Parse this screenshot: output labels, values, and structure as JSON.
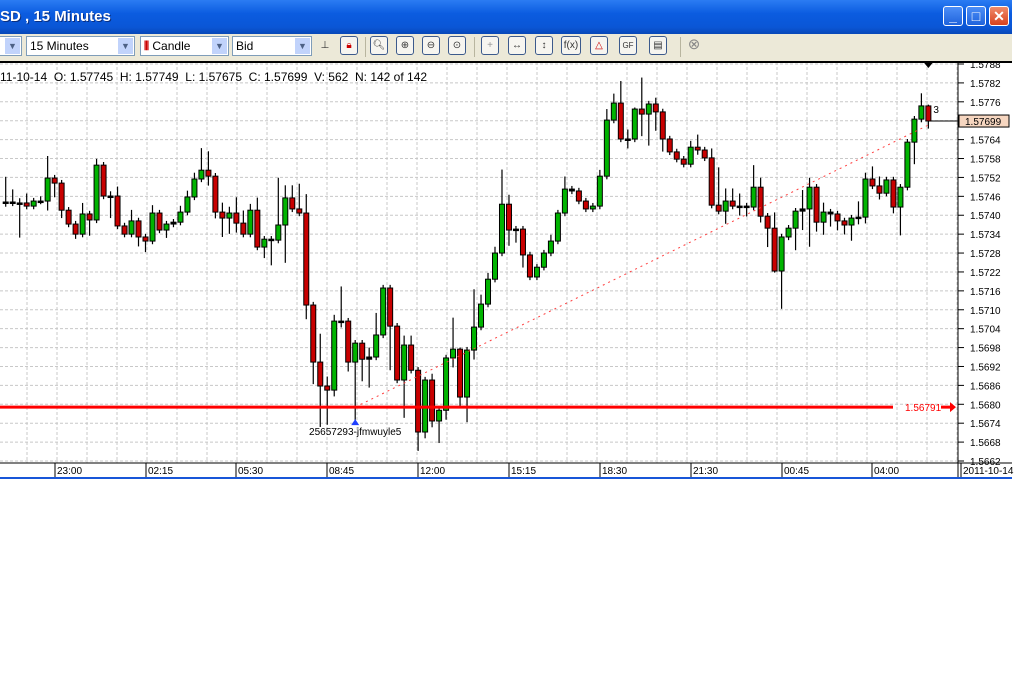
{
  "window": {
    "title": "SD , 15 Minutes",
    "minimize_icon": "minimize-icon",
    "maximize_icon": "maximize-icon",
    "close_icon": "close-icon"
  },
  "toolbar": {
    "symbol_value": "",
    "period_value": "15 Minutes",
    "chart_type_value": "Candle",
    "price_type_value": "Bid",
    "buttons": {
      "fx_label": "f(x)",
      "gf_label": "GF"
    }
  },
  "info": {
    "date": "11-10-14",
    "open": "O: 1.57745",
    "high": "H: 1.57749",
    "low": "L: 1.57675",
    "close": "C: 1.57699",
    "volume": "V: 562",
    "count": "N: 142 of 142"
  },
  "price_line": {
    "label": "1.56791",
    "price": 1.56791,
    "color": "#ff0000"
  },
  "current_price": {
    "label": "1.57699",
    "price": 1.57699
  },
  "marker_label": "3",
  "order": {
    "label": "25657293-jfmwuyle5",
    "price": 1.56791,
    "candle": 51
  },
  "colors": {
    "up": "#00b400",
    "down": "#c80000",
    "grid": "#c8c8c8"
  },
  "chart_data": {
    "type": "candlestick",
    "ylim": [
      1.5662,
      1.5788
    ],
    "y_ticks": [
      "1.5788",
      "1.5782",
      "1.5776",
      "1.5770",
      "1.5764",
      "1.5758",
      "1.5752",
      "1.5746",
      "1.5740",
      "1.5734",
      "1.5728",
      "1.5722",
      "1.5716",
      "1.5710",
      "1.5704",
      "1.5698",
      "1.5692",
      "1.5686",
      "1.5680",
      "1.5674",
      "1.5668",
      "1.5662"
    ],
    "x_ticks": [
      {
        "label": "23:00",
        "candle": 8
      },
      {
        "label": "02:15",
        "candle": 21
      },
      {
        "label": "05:30",
        "candle": 34
      },
      {
        "label": "08:45",
        "candle": 47
      },
      {
        "label": "12:00",
        "candle": 60
      },
      {
        "label": "15:15",
        "candle": 73
      },
      {
        "label": "18:30",
        "candle": 86
      },
      {
        "label": "21:30",
        "candle": 99
      },
      {
        "label": "00:45",
        "candle": 112
      },
      {
        "label": "04:00",
        "candle": 125
      }
    ],
    "x_axis_date": "2011-10-14",
    "close": [
      1.57442,
      1.57439,
      1.57439,
      1.57429,
      1.57445,
      1.57445,
      1.57518,
      1.57502,
      1.57416,
      1.57372,
      1.5734,
      1.57404,
      1.57385,
      1.57559,
      1.57461,
      1.57461,
      1.57366,
      1.5734,
      1.57382,
      1.57331,
      1.57318,
      1.57407,
      1.57353,
      1.57372,
      1.57378,
      1.5741,
      1.57458,
      1.57515,
      1.57543,
      1.57524,
      1.5741,
      1.57391,
      1.57407,
      1.57375,
      1.5734,
      1.57416,
      1.57299,
      1.57324,
      1.57321,
      1.57369,
      1.57455,
      1.5742,
      1.57407,
      1.57115,
      1.56934,
      1.56858,
      1.56845,
      1.57064,
      1.57064,
      1.56934,
      1.56994,
      1.56943,
      1.5695,
      1.5702,
      1.57169,
      1.57048,
      1.56877,
      1.56988,
      1.56908,
      1.56712,
      1.56877,
      1.56747,
      1.56781,
      1.56947,
      1.56975,
      1.56823,
      1.56972,
      1.57045,
      1.57118,
      1.57197,
      1.5728,
      1.57435,
      1.57353,
      1.57356,
      1.57274,
      1.57204,
      1.57235,
      1.5728,
      1.57318,
      1.57407,
      1.57483,
      1.57477,
      1.57445,
      1.5742,
      1.57429,
      1.57524,
      1.57702,
      1.57756,
      1.57642,
      1.57642,
      1.57737,
      1.57721,
      1.57753,
      1.57728,
      1.57642,
      1.57601,
      1.57578,
      1.57562,
      1.57616,
      1.57607,
      1.57582,
      1.57432,
      1.57413,
      1.57445,
      1.57429,
      1.57429,
      1.57426,
      1.57489,
      1.57397,
      1.57359,
      1.57223,
      1.57331,
      1.57359,
      1.57413,
      1.5742,
      1.57489,
      1.57378,
      1.5741,
      1.57404,
      1.57382,
      1.57369,
      1.57391,
      1.57394,
      1.57515,
      1.57493,
      1.5747,
      1.57512,
      1.57426,
      1.57489,
      1.57632,
      1.57705,
      1.57747,
      1.57699
    ],
    "upper_wick_pips": [
      8,
      4,
      1.5,
      3,
      1,
      1.5,
      7,
      1,
      1,
      1,
      1,
      3.5,
      1,
      2,
      1,
      1.5,
      3,
      1,
      3.5,
      1,
      1,
      2.5,
      1,
      1,
      1,
      2,
      2,
      2,
      7,
      6,
      1,
      3,
      2,
      5,
      4,
      2,
      4,
      1,
      1,
      15,
      4,
      4,
      8,
      6,
      1,
      9,
      3,
      2,
      11,
      1,
      1,
      1,
      3,
      7,
      1,
      1,
      1,
      3,
      3,
      1,
      1,
      2,
      1,
      1,
      10,
      0.5,
      1,
      12,
      3,
      2,
      2,
      11,
      3,
      1,
      1,
      1,
      1,
      1,
      2,
      1,
      4,
      1,
      1,
      1,
      1,
      2,
      3.5,
      3,
      7,
      3,
      0.5,
      10,
      1,
      2,
      1,
      1,
      1,
      1,
      2,
      4,
      1,
      3,
      12,
      4,
      4,
      4,
      1,
      7,
      3,
      1,
      5,
      1,
      1,
      1,
      6,
      3,
      1,
      3,
      1,
      1,
      1,
      1,
      5,
      2,
      4,
      3,
      1,
      1,
      1,
      1,
      1,
      4,
      0.4
    ],
    "lower_wick_pips": [
      1.5,
      1,
      11,
      1,
      1,
      1,
      3,
      4.5,
      2.5,
      1,
      1.5,
      1,
      5,
      1,
      1,
      7,
      1,
      1,
      1,
      3,
      3.5,
      1,
      1,
      2.5,
      1,
      1,
      1,
      1,
      1,
      3,
      2,
      6,
      5,
      3,
      1,
      1,
      1,
      3.5,
      8,
      1,
      12,
      1,
      1,
      4.5,
      7,
      13,
      11,
      2,
      2,
      3,
      19,
      7,
      9,
      1,
      1,
      14,
      1,
      12,
      1,
      6,
      2,
      2,
      7,
      3,
      3,
      3,
      8,
      3,
      1,
      1,
      1,
      1,
      5,
      4,
      4,
      1,
      1,
      1,
      1,
      1,
      1,
      1,
      1,
      1,
      1,
      1,
      1,
      1,
      1,
      3,
      1,
      7,
      10,
      6,
      4,
      1,
      1,
      1,
      1,
      1.5,
      1,
      1,
      1,
      4,
      1,
      3,
      3,
      1,
      2,
      6,
      0.5,
      12,
      1,
      7,
      6,
      12,
      3,
      4,
      4,
      3,
      3,
      5,
      2,
      2,
      1,
      2,
      1,
      2,
      9,
      1,
      7,
      1,
      2.4
    ]
  }
}
